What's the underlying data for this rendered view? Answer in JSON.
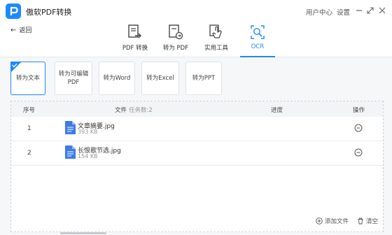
{
  "app": {
    "title": "傲软PDF转换",
    "user_center": "用户中心",
    "settings": "设置"
  },
  "nav": {
    "back": "返回"
  },
  "tools": [
    {
      "label": "PDF 转换",
      "icon": "pdf-convert-icon"
    },
    {
      "label": "转为 PDF",
      "icon": "to-pdf-icon"
    },
    {
      "label": "实用工具",
      "icon": "hand-tool-icon"
    },
    {
      "label": "OCR",
      "icon": "ocr-icon",
      "active": true
    }
  ],
  "options": [
    {
      "label": "转为文本",
      "active": true
    },
    {
      "label": "转为可编辑PDF"
    },
    {
      "label": "转为Word"
    },
    {
      "label": "转为Excel"
    },
    {
      "label": "转为PPT"
    }
  ],
  "table": {
    "col_index": "序号",
    "col_file": "文件",
    "col_task_count": "任务数:2",
    "col_progress": "进度",
    "col_action": "操作",
    "rows": [
      {
        "index": "1",
        "name": "文章摘要.jpg",
        "size": "393 KB"
      },
      {
        "index": "2",
        "name": "长恨歌节选.jpg",
        "size": "154 KB"
      }
    ]
  },
  "footer": {
    "add_file": "添加文件",
    "clear": "清空"
  },
  "colors": {
    "accent": "#1e88ff",
    "file_icon": "#3d7bea"
  }
}
